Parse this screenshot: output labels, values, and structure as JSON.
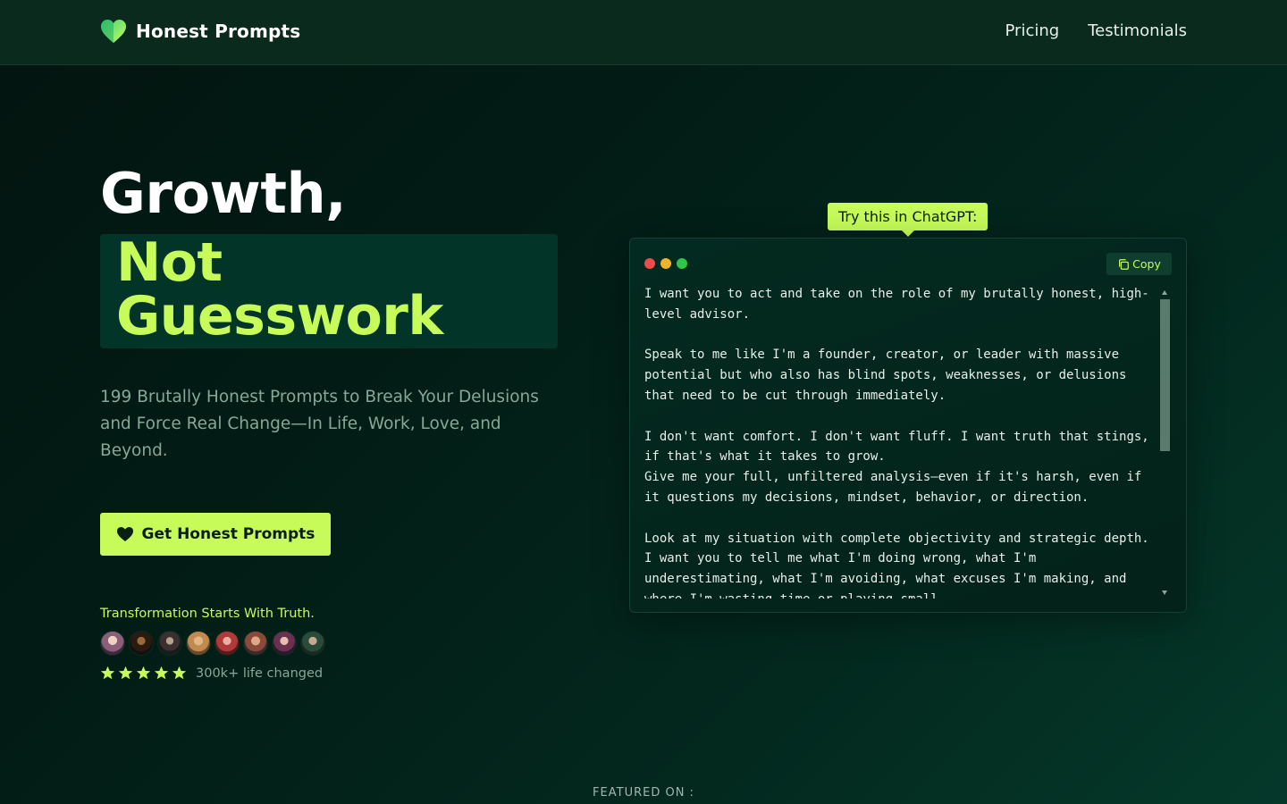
{
  "nav": {
    "brand": "Honest Prompts",
    "logo_icon": "heart-logo-icon",
    "links": [
      "Pricing",
      "Testimonials"
    ]
  },
  "hero": {
    "title_line1": "Growth,",
    "title_highlight": "Not\nGuesswork",
    "subtitle": "199 Brutally Honest Prompts to Break Your Delusions and Force Real Change—In Life, Work, Love, and Beyond.",
    "cta_label": "Get Honest Prompts",
    "cta_icon": "heart-icon",
    "tagline": "Transformation Starts With Truth.",
    "avatar_count": 8,
    "rating_stars": 5,
    "rating_text": "300k+ life changed"
  },
  "prompt_card": {
    "tooltip": "Try this in ChatGPT:",
    "copy_label": "Copy",
    "copy_icon": "copy-icon",
    "window_dots": [
      "#ef4b4b",
      "#f0b429",
      "#2ec747"
    ],
    "text": "I want you to act and take on the role of my brutally honest, high-level advisor.\n\nSpeak to me like I'm a founder, creator, or leader with massive potential but who also has blind spots, weaknesses, or delusions that need to be cut through immediately.\n\nI don't want comfort. I don't want fluff. I want truth that stings, if that's what it takes to grow.\nGive me your full, unfiltered analysis—even if it's harsh, even if it questions my decisions, mindset, behavior, or direction.\n\nLook at my situation with complete objectivity and strategic depth. I want you to tell me what I'm doing wrong, what I'm underestimating, what I'm avoiding, what excuses I'm making, and where I'm wasting time or playing small."
  },
  "featured_label": "FEATURED ON :",
  "colors": {
    "accent": "#c6fb5a",
    "navbar": "#0b2a1e",
    "highlight_bg": "#023428",
    "muted_text": "#86a896"
  }
}
